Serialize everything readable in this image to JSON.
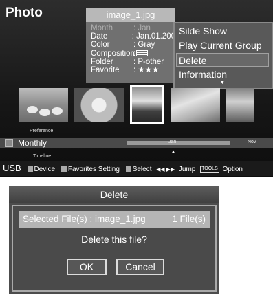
{
  "screen": {
    "title": "Photo",
    "file_info": {
      "file_name": "image_1.jpg",
      "rows": [
        {
          "key": "Month",
          "value": ": Jan"
        },
        {
          "key": "Date",
          "value": ": Jan.01.200"
        },
        {
          "key": "Color",
          "value": ": Gray"
        },
        {
          "key": "Composition",
          "value": ":"
        },
        {
          "key": "Folder",
          "value": ": P-other"
        },
        {
          "key": "Favorite",
          "value": ": ★★★"
        }
      ]
    },
    "menu": {
      "items": [
        "Silde Show",
        "Play Current Group",
        "Delete",
        "Information"
      ],
      "selected_index": 2,
      "more_arrow": "▼"
    },
    "timeline": {
      "preference_label": "Preference",
      "mode": "Monthly",
      "start_month": "Jan",
      "end_month": "Nov",
      "marker": "▲",
      "timeline_label": "Timeline"
    },
    "statusbar": {
      "source": "USB",
      "device": "Device",
      "favorites": "Favorites Setting",
      "select": "Select",
      "jump_arrows": "◀◀ ▶▶",
      "jump": "Jump",
      "tools": "TOOLS",
      "option": "Option"
    }
  },
  "dialog": {
    "title": "Delete",
    "selected_label": "Selected File(s) : image_1.jpg",
    "count_label": "1 File(s)",
    "question": "Delete this file?",
    "ok": "OK",
    "cancel": "Cancel"
  }
}
